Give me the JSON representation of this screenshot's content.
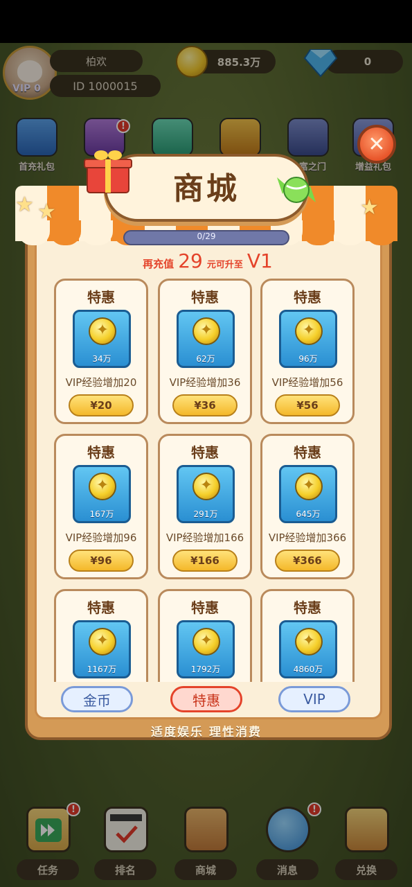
{
  "profile": {
    "name": "柏欢",
    "id": "ID 1000015",
    "vip": "VIP 0"
  },
  "currency": {
    "coins": "885.3万",
    "gems": "0"
  },
  "activities": [
    {
      "label": "首充礼包",
      "badge": ""
    },
    {
      "label": "",
      "badge": "!"
    },
    {
      "label": "",
      "badge": ""
    },
    {
      "label": "",
      "badge": ""
    },
    {
      "label": "大富之门",
      "badge": ""
    },
    {
      "label": "增益礼包",
      "badge": ""
    }
  ],
  "shop": {
    "title": "商城",
    "progress_text": "0/29",
    "progress_fraction": 0.0,
    "upgrade": {
      "prefix": "再充值",
      "amount": "29",
      "suffix": "元可升至",
      "level": "V1"
    },
    "items": [
      {
        "tag": "特惠",
        "amount": "34万",
        "desc": "VIP经验增加20",
        "price": "¥20"
      },
      {
        "tag": "特惠",
        "amount": "62万",
        "desc": "VIP经验增加36",
        "price": "¥36"
      },
      {
        "tag": "特惠",
        "amount": "96万",
        "desc": "VIP经验增加56",
        "price": "¥56"
      },
      {
        "tag": "特惠",
        "amount": "167万",
        "desc": "VIP经验增加96",
        "price": "¥96"
      },
      {
        "tag": "特惠",
        "amount": "291万",
        "desc": "VIP经验增加166",
        "price": "¥166"
      },
      {
        "tag": "特惠",
        "amount": "645万",
        "desc": "VIP经验增加366",
        "price": "¥366"
      },
      {
        "tag": "特惠",
        "amount": "1167万",
        "desc": "",
        "price": ""
      },
      {
        "tag": "特惠",
        "amount": "1792万",
        "desc": "",
        "price": ""
      },
      {
        "tag": "特惠",
        "amount": "4860万",
        "desc": "",
        "price": ""
      }
    ],
    "tabs": [
      {
        "label": "金币",
        "active": false
      },
      {
        "label": "特惠",
        "active": true
      },
      {
        "label": "VIP",
        "active": false
      }
    ],
    "footer": "适度娱乐 理性消费"
  },
  "bottom_nav": [
    {
      "label": "任务",
      "badge": "!"
    },
    {
      "label": "排名",
      "badge": ""
    },
    {
      "label": "商城",
      "badge": ""
    },
    {
      "label": "消息",
      "badge": "!"
    },
    {
      "label": "兑换",
      "badge": ""
    }
  ],
  "colors": {
    "accent_red": "#e4432a",
    "panel": "#d49a56",
    "tile_blue": "#2a8fd2",
    "price_gold": "#f4b82a"
  }
}
